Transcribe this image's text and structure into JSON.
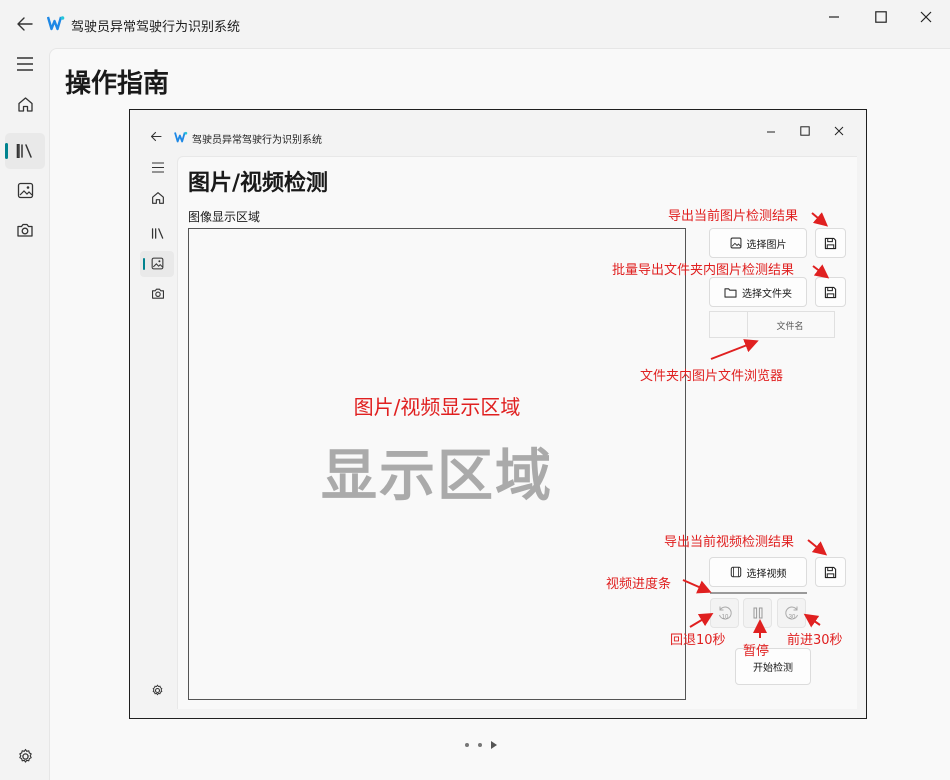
{
  "window": {
    "app_title": "驾驶员异常驾驶行为识别系统",
    "controls": [
      "minimize",
      "maximize",
      "close"
    ]
  },
  "nav": {
    "items": [
      {
        "name": "menu",
        "icon": "hamburger-icon"
      },
      {
        "name": "home",
        "icon": "home-icon"
      },
      {
        "name": "guide",
        "icon": "library-icon",
        "active": true
      },
      {
        "name": "image-detection",
        "icon": "image-icon"
      },
      {
        "name": "camera-detection",
        "icon": "camera-icon"
      }
    ],
    "footer_icon": "settings-icon"
  },
  "page": {
    "title": "操作指南"
  },
  "guide_screenshot": {
    "app_title": "驾驶员异常驾驶行为识别系统",
    "page_title": "图片/视频检测",
    "area_label": "图像显示区域",
    "display_caption": "图片/视频显示区域",
    "display_watermark": "显示区域",
    "buttons": {
      "select_image": "选择图片",
      "select_folder": "选择文件夹",
      "select_video": "选择视频",
      "start_detection": "开始检测",
      "rewind_label": "10",
      "forward_label": "30"
    },
    "file_list_header": "文件名",
    "annotations": {
      "export_image": "导出当前图片检测结果",
      "export_folder": "批量导出文件夹内图片检测结果",
      "file_browser": "文件夹内图片文件浏览器",
      "export_video": "导出当前视频检测结果",
      "video_progress": "视频进度条",
      "rewind": "回退10秒",
      "pause": "暂停",
      "forward": "前进30秒"
    },
    "annotation_color": "#e02020"
  },
  "colors": {
    "accent": "#00838f",
    "logo": "#1e88e5"
  }
}
